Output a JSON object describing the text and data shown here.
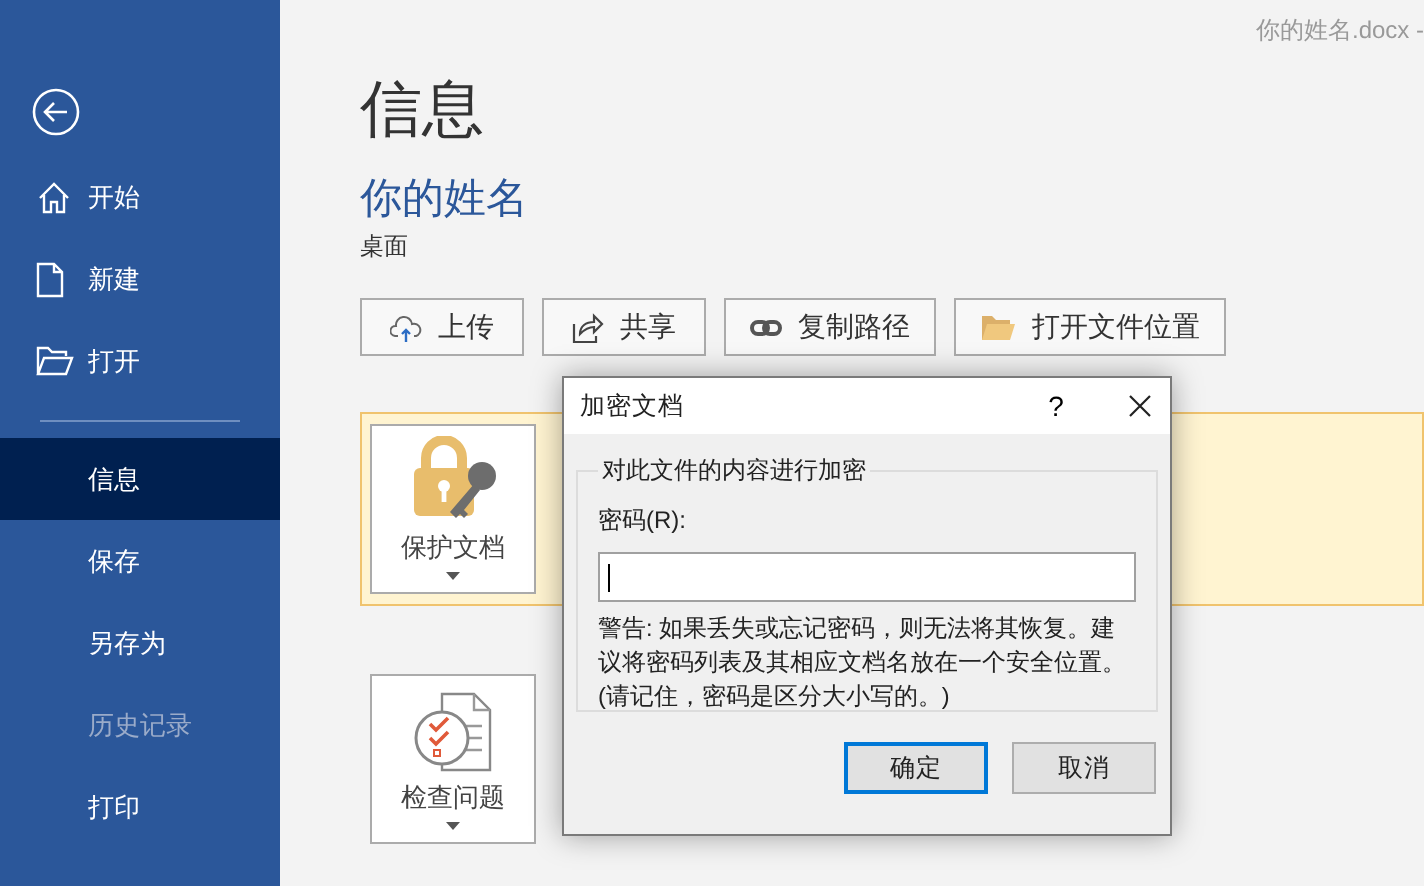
{
  "window": {
    "title": "你的姓名.docx -"
  },
  "sidebar": {
    "items": [
      {
        "label": "开始",
        "kind": "home",
        "selected": false,
        "disabled": false
      },
      {
        "label": "新建",
        "kind": "new",
        "selected": false,
        "disabled": false
      },
      {
        "label": "打开",
        "kind": "open",
        "selected": false,
        "disabled": false
      },
      {
        "label": "信息",
        "kind": "plain",
        "selected": true,
        "disabled": false
      },
      {
        "label": "保存",
        "kind": "plain",
        "selected": false,
        "disabled": false
      },
      {
        "label": "另存为",
        "kind": "plain",
        "selected": false,
        "disabled": false
      },
      {
        "label": "历史记录",
        "kind": "plain",
        "selected": false,
        "disabled": true
      },
      {
        "label": "打印",
        "kind": "plain",
        "selected": false,
        "disabled": false
      }
    ]
  },
  "page": {
    "heading": "信息",
    "doc_name": "你的姓名",
    "location": "桌面",
    "actions": [
      {
        "label": "上传",
        "kind": "upload"
      },
      {
        "label": "共享",
        "kind": "share"
      },
      {
        "label": "复制路径",
        "kind": "link"
      },
      {
        "label": "打开文件位置",
        "kind": "folder"
      }
    ],
    "cards": [
      {
        "label": "保护文档",
        "kind": "protect",
        "highlighted": true
      },
      {
        "label": "检查问题",
        "kind": "inspect",
        "highlighted": false
      }
    ]
  },
  "dialog": {
    "title": "加密文档",
    "help": "?",
    "group_label": "对此文件的内容进行加密",
    "password_label": "密码(R):",
    "password_focused": true,
    "warning": "警告: 如果丢失或忘记密码，则无法将其恢复。建议将密码列表及其相应文档名放在一个安全位置。(请记住，密码是区分大小写的。)",
    "buttons": [
      {
        "label": "确定",
        "default": true
      },
      {
        "label": "取消",
        "default": false
      }
    ]
  }
}
